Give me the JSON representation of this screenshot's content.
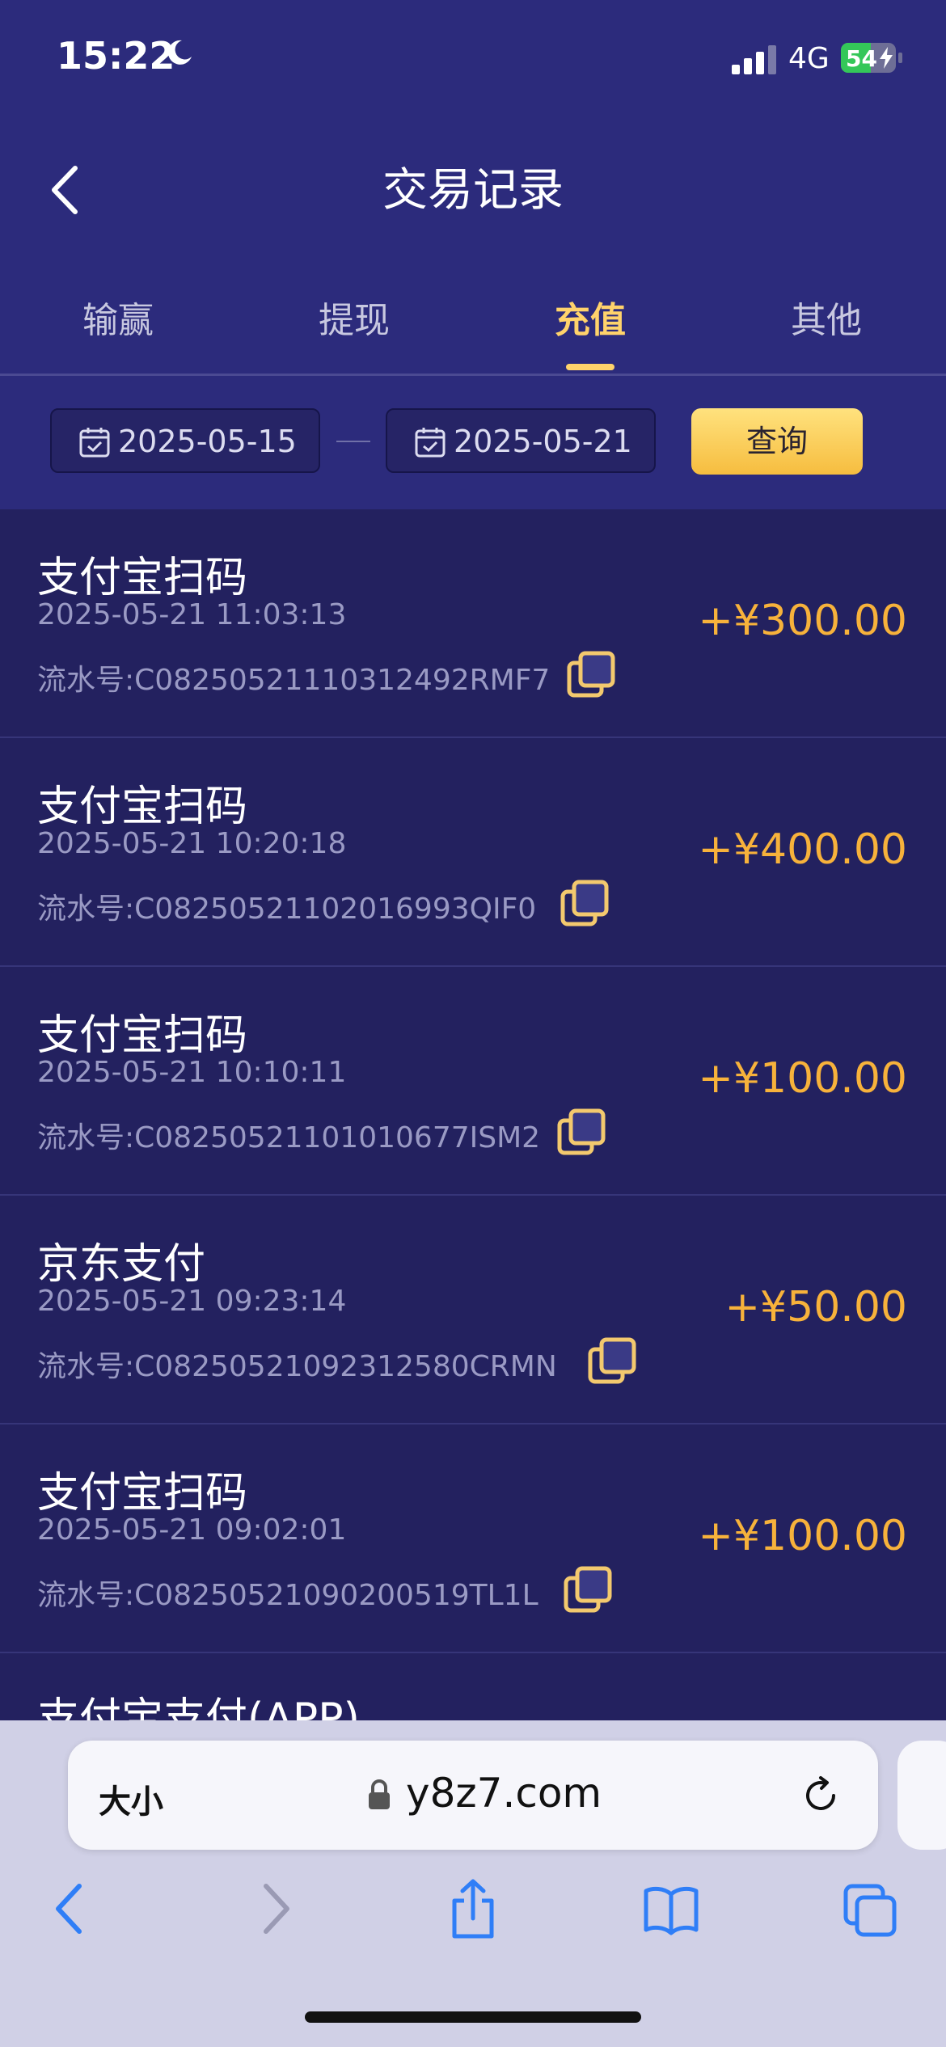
{
  "status_bar": {
    "time": "15:22",
    "network": "4G",
    "battery": "54",
    "battery_level": 0.54
  },
  "header": {
    "title": "交易记录"
  },
  "tabs": [
    {
      "label": "输赢",
      "active": false
    },
    {
      "label": "提现",
      "active": false
    },
    {
      "label": "充值",
      "active": true
    },
    {
      "label": "其他",
      "active": false
    }
  ],
  "filter": {
    "start_date": "2025-05-15",
    "end_date": "2025-05-21",
    "query_label": "查询"
  },
  "records": [
    {
      "name": "支付宝扫码",
      "time": "2025-05-21 11:03:13",
      "serial": "流水号:C08250521110312492RMF7",
      "amount": "+¥300.00"
    },
    {
      "name": "支付宝扫码",
      "time": "2025-05-21 10:20:18",
      "serial": "流水号:C08250521102016993QIF0",
      "amount": "+¥400.00"
    },
    {
      "name": "支付宝扫码",
      "time": "2025-05-21 10:10:11",
      "serial": "流水号:C08250521101010677ISM2",
      "amount": "+¥100.00"
    },
    {
      "name": "京东支付",
      "time": "2025-05-21 09:23:14",
      "serial": "流水号:C08250521092312580CRMN",
      "amount": "+¥50.00"
    },
    {
      "name": "支付宝扫码",
      "time": "2025-05-21 09:02:01",
      "serial": "流水号:C08250521090200519TL1L",
      "amount": "+¥100.00"
    },
    {
      "name": "支付宝支付(APP)",
      "time": "",
      "serial": "",
      "amount": ""
    }
  ],
  "browser": {
    "text_size_label": "大小",
    "url": "y8z7.com"
  },
  "colors": {
    "header_bg": "#2c2b7c",
    "list_bg": "#23215f",
    "accent": "#ffd36b",
    "amount": "#f7b23b"
  }
}
